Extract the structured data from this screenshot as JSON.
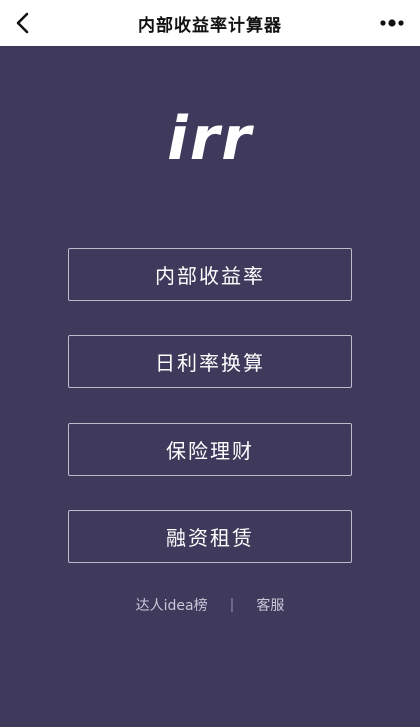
{
  "navbar": {
    "title": "内部收益率计算器",
    "back_icon": "chevron-left-icon",
    "more_icon": "more-dots-icon"
  },
  "logo": {
    "text": "irr"
  },
  "menu": [
    {
      "label": "内部收益率"
    },
    {
      "label": "日利率换算"
    },
    {
      "label": "保险理财"
    },
    {
      "label": "融资租赁"
    }
  ],
  "footer": {
    "left_link": "达人idea榜",
    "separator": "|",
    "right_link": "客服"
  },
  "colors": {
    "background": "#3f3a5b",
    "navbar": "#ffffff",
    "button_border": "#bdbacb",
    "text": "#ffffff"
  }
}
